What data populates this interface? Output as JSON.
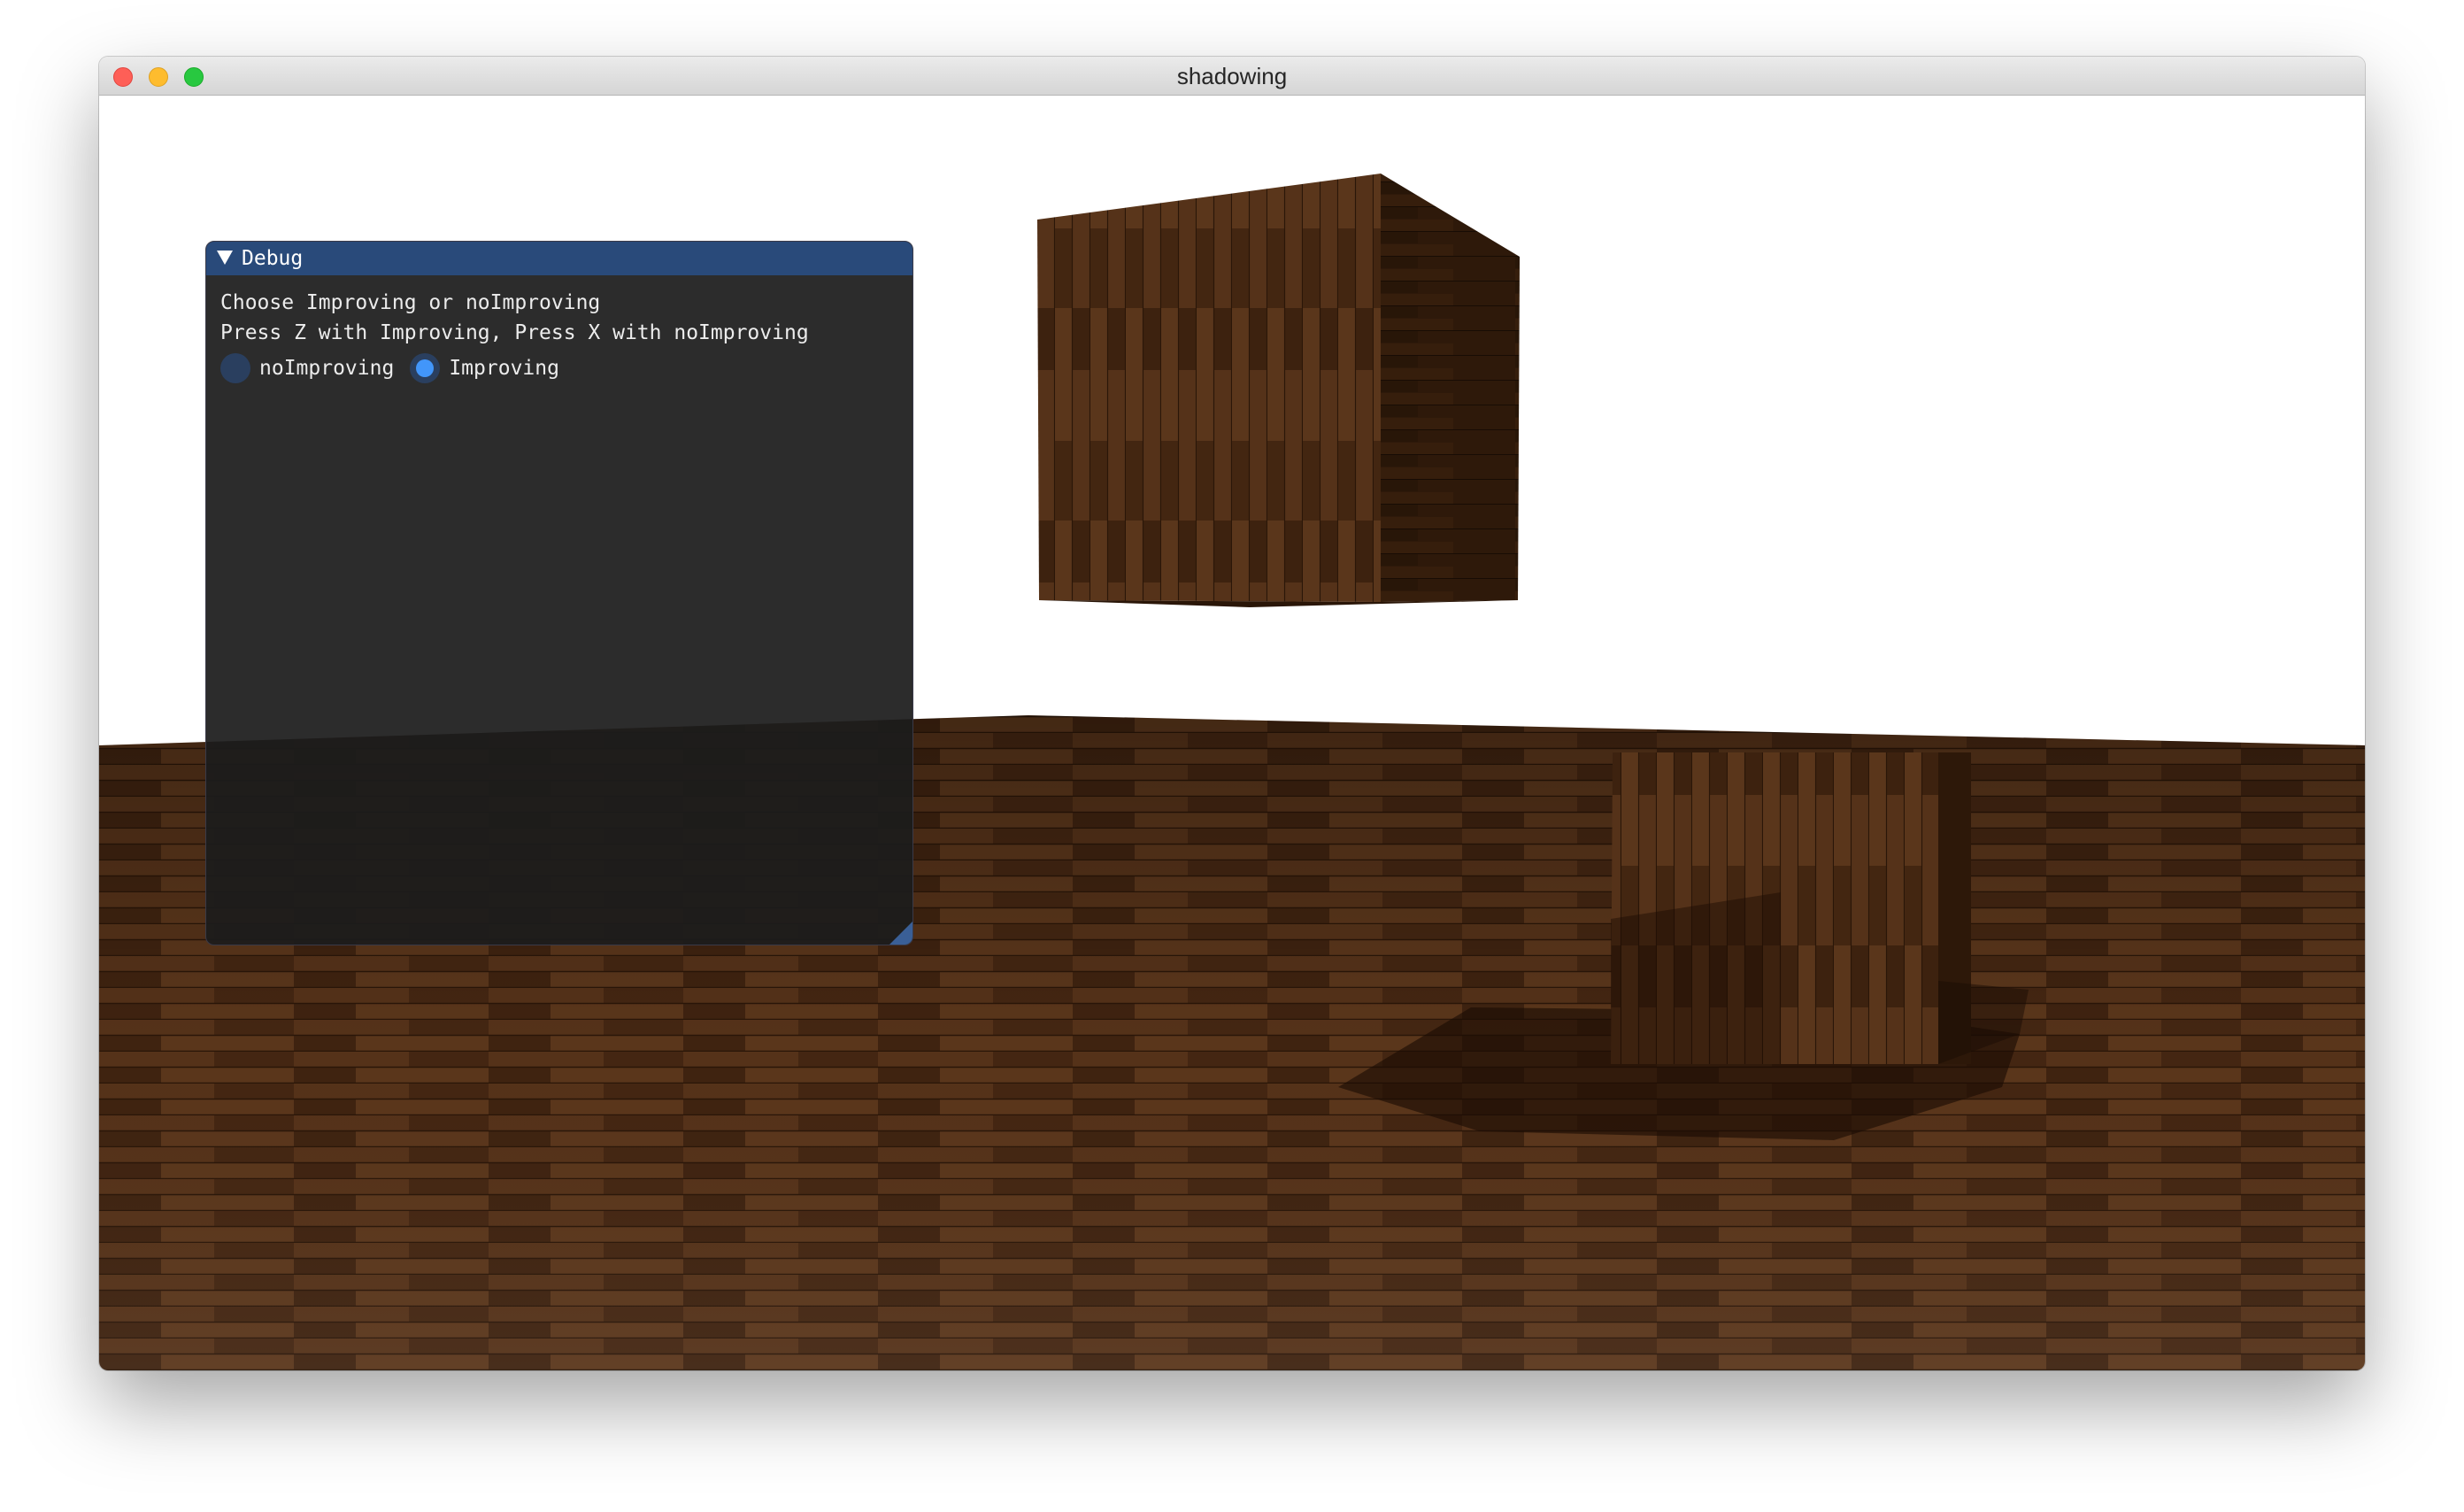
{
  "window": {
    "title": "shadowing"
  },
  "debug_panel": {
    "title": "Debug",
    "lines": [
      "Choose Improving or noImproving",
      "Press Z with Improving, Press X with noImproving"
    ],
    "radio_options": [
      {
        "label": "noImproving",
        "selected": false
      },
      {
        "label": "Improving",
        "selected": true
      }
    ]
  },
  "colors": {
    "titlebar_accent": "#294a7a",
    "radio_active": "#4296fa",
    "floor_wood": "#4a2b15",
    "cube_wood": "#4e2e16",
    "background": "#ffffff"
  },
  "icons": [
    "close-icon",
    "minimize-icon",
    "zoom-icon",
    "collapse-arrow-icon",
    "resize-grip-icon"
  ]
}
